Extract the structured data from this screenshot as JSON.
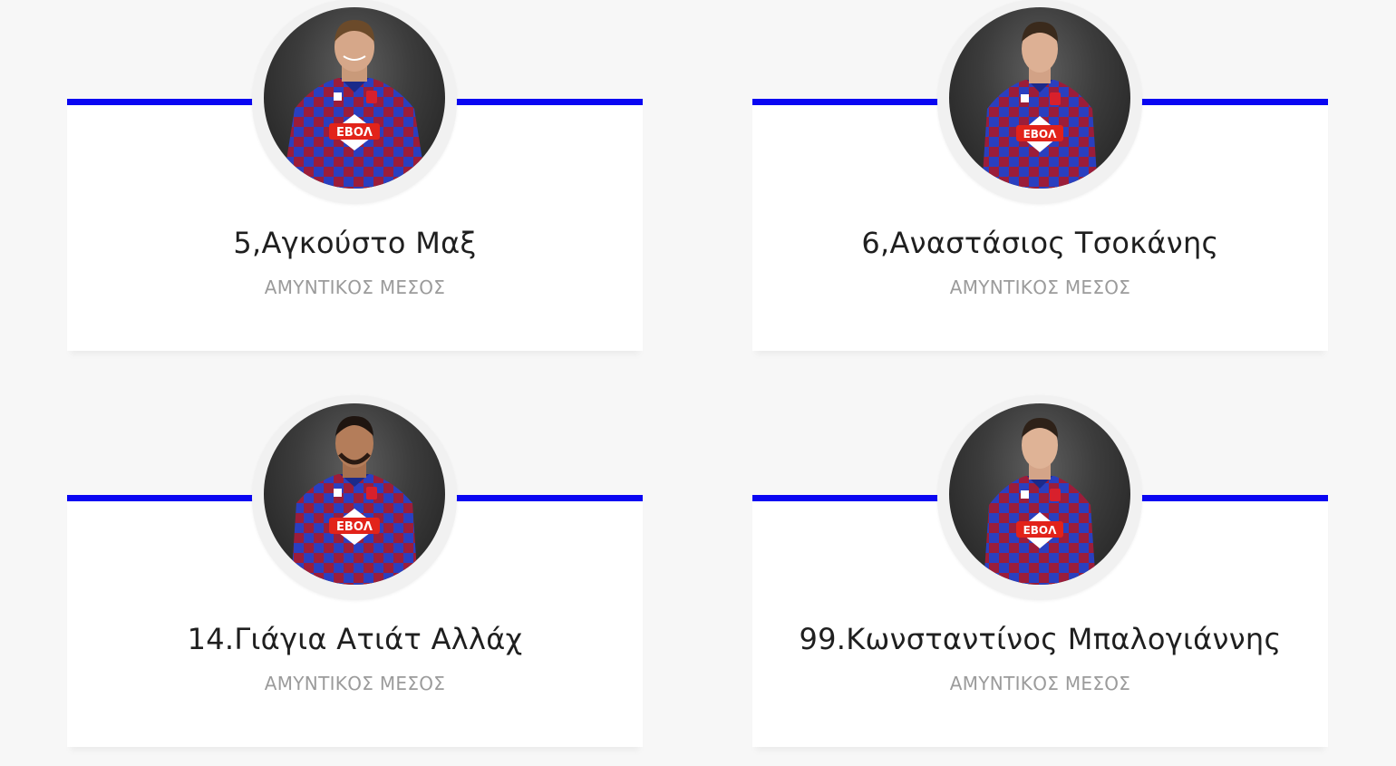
{
  "colors": {
    "accent_line": "#0a06f2",
    "page_background": "#f7f7f7",
    "card_background": "#ffffff",
    "name_text": "#1f1f1f",
    "position_text": "#9b9b9b",
    "kit_blue": "#2a3fbf",
    "kit_red": "#9b1d3a"
  },
  "players": [
    {
      "name": "5,Αγκούστο Μαξ",
      "position": "ΑΜΥΝΤΙΚΟΣ ΜΕΣΟΣ",
      "sponsor": "ΕΒΟΛ",
      "photo": "player-photo"
    },
    {
      "name": "6,Αναστάσιος Τσοκάνης",
      "position": "ΑΜΥΝΤΙΚΟΣ ΜΕΣΟΣ",
      "sponsor": "ΕΒΟΛ",
      "photo": "player-photo"
    },
    {
      "name": "14.Γιάγια Ατιάτ Αλλάχ",
      "position": "ΑΜΥΝΤΙΚΟΣ ΜΕΣΟΣ",
      "sponsor": "ΕΒΟΛ",
      "photo": "player-photo"
    },
    {
      "name": "99.Κωνσταντίνος Μπαλογιάννης",
      "position": "ΑΜΥΝΤΙΚΟΣ ΜΕΣΟΣ",
      "sponsor": "ΕΒΟΛ",
      "photo": "player-photo"
    }
  ]
}
